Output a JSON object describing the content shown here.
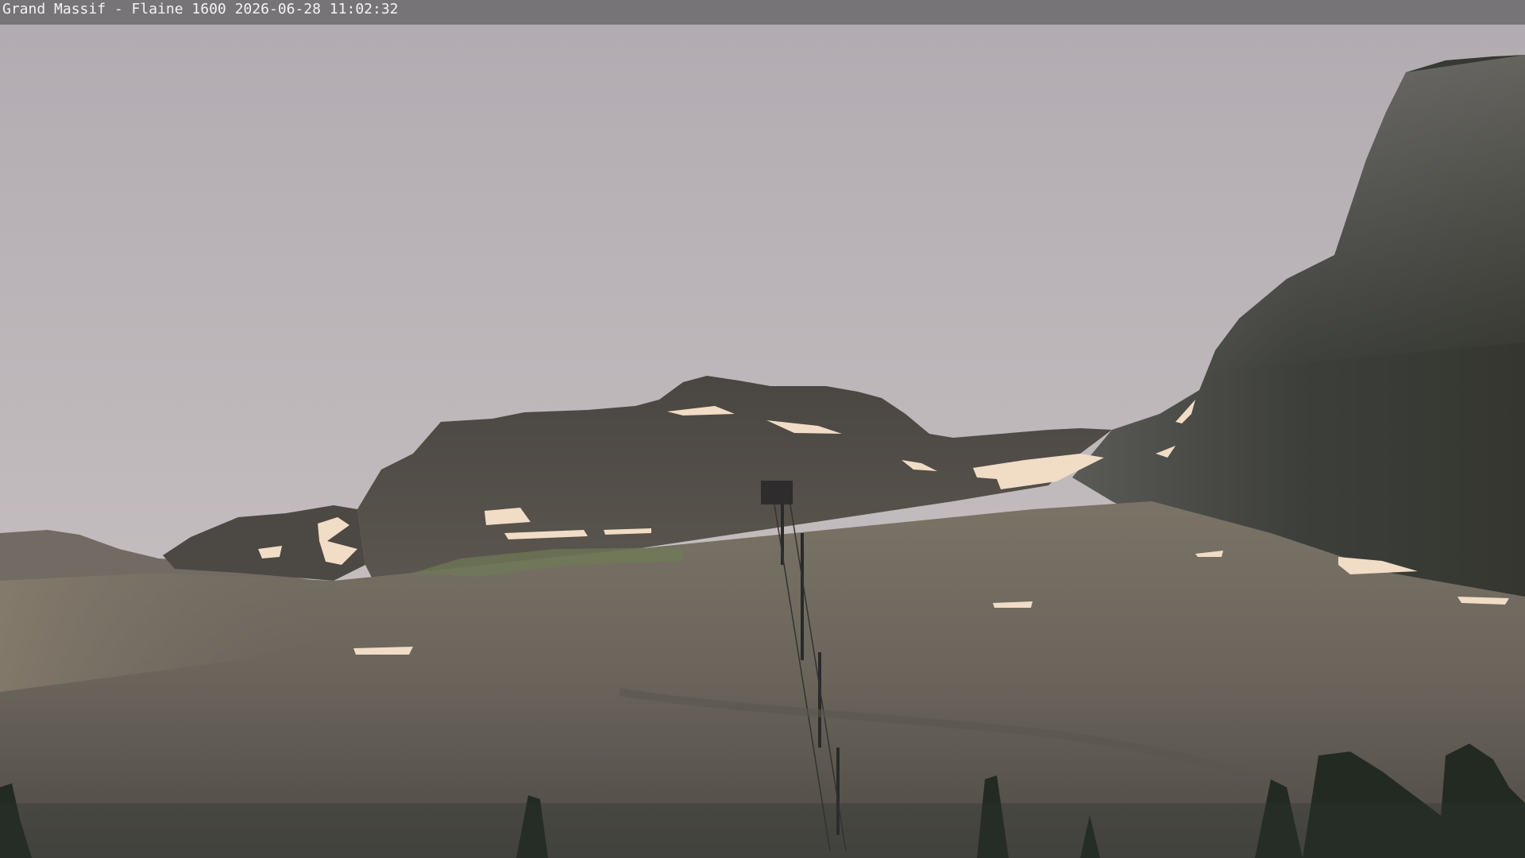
{
  "webcam": {
    "overlay_caption": "Grand Massif - Flaine 1600 2026-06-28 11:02:32"
  },
  "palette": {
    "sky_top": "#b4adb3",
    "sky_bottom": "#cdc4c3",
    "snow": "#f2dcc8",
    "rock_dark": "#3e3b38",
    "slope": "#6b655c",
    "trees": "#232a23"
  }
}
